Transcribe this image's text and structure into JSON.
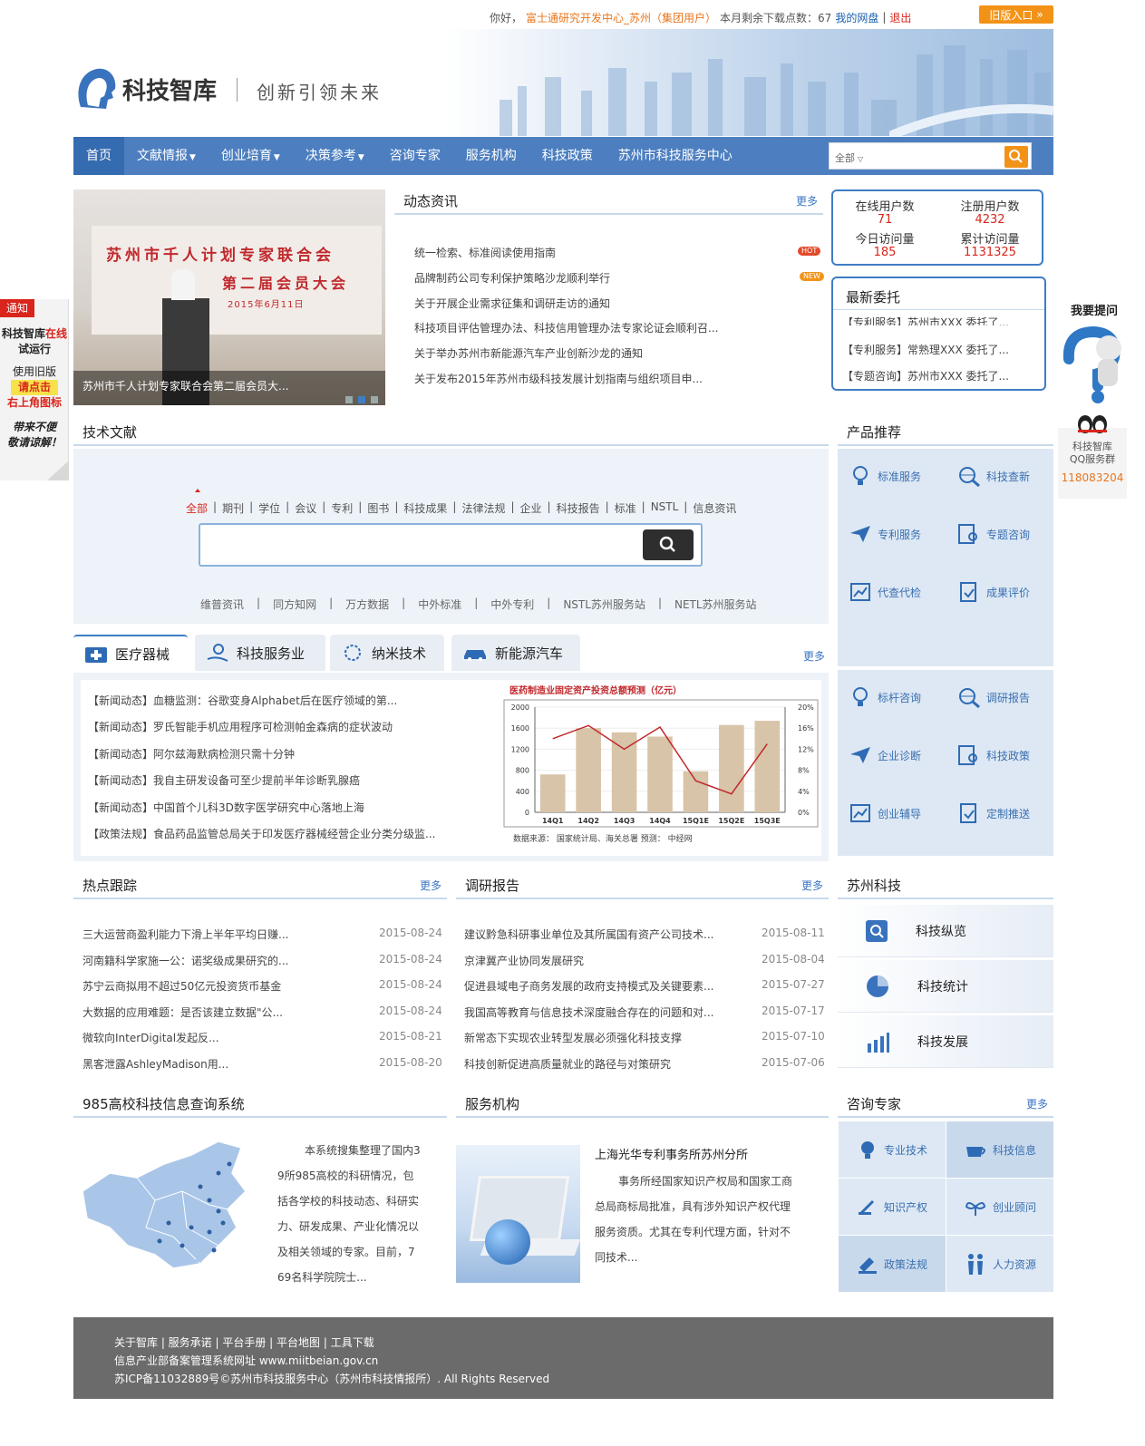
{
  "topbar": {
    "greeting": "你好，",
    "user": "富士通研究开发中心_苏州（集团用户）",
    "quota_label": "本月剩余下载点数：67",
    "my_disk": "我的网盘",
    "logout": "退出",
    "old_version": "旧版入口"
  },
  "header": {
    "logo_text": "科技智库",
    "slogan": "创新引领未来"
  },
  "nav": {
    "items": [
      {
        "label": "首页"
      },
      {
        "label": "文献情报"
      },
      {
        "label": "创业培育"
      },
      {
        "label": "决策参考"
      },
      {
        "label": "咨询专家"
      },
      {
        "label": "服务机构"
      },
      {
        "label": "科技政策"
      },
      {
        "label": "苏州市科技服务中心"
      }
    ],
    "search_scope": "全部"
  },
  "banner": {
    "line1": "苏州市千人计划专家联合会",
    "line2": "第二届会员大会",
    "line3": "2015年6月11日",
    "caption": "苏州市千人计划专家联合会第二届会员大..."
  },
  "news": {
    "title": "动态资讯",
    "more": "更多",
    "items": [
      "统一检索、标准阅读使用指南",
      "品牌制药公司专利保护策略沙龙顺利举行",
      "关于开展企业需求征集和调研走访的通知",
      "科技项目评估管理办法、科技信用管理办法专家论证会顺利召...",
      "关于举办苏州市新能源汽车产业创新沙龙的通知",
      "关于发布2015年苏州市级科技发展计划指南与组织项目申..."
    ],
    "hot": "HOT",
    "new": "NEW"
  },
  "stats": {
    "online_label": "在线用户数",
    "online": "71",
    "registered_label": "注册用户数",
    "registered": "4232",
    "today_label": "今日访问量",
    "today": "185",
    "total_label": "累计访问量",
    "total": "1131325"
  },
  "commission": {
    "title": "最新委托",
    "items": [
      "【专利服务】苏州市XXX 委托了...",
      "【专利服务】常熟理XXX 委托了...",
      "【专题咨询】苏州市XXX 委托了..."
    ]
  },
  "literature": {
    "title": "技术文献",
    "tabs": [
      "全部",
      "期刊",
      "学位",
      "会议",
      "专利",
      "图书",
      "科技成果",
      "法律法规",
      "企业",
      "科技报告",
      "标准",
      "NSTL",
      "信息资讯"
    ],
    "sources": [
      "维普资讯",
      "同方知网",
      "万方数据",
      "中外标准",
      "中外专利",
      "NSTL苏州服务站",
      "NETL苏州服务站"
    ]
  },
  "products": {
    "title": "产品推荐",
    "group1": [
      "标准服务",
      "科技查新",
      "专利服务",
      "专题咨询",
      "代查代检",
      "成果评价"
    ],
    "group2": [
      "标杆咨询",
      "调研报告",
      "企业诊断",
      "科技政策",
      "创业辅导",
      "定制推送"
    ]
  },
  "industry": {
    "tabs": [
      "医疗器械",
      "科技服务业",
      "纳米技术",
      "新能源汽车"
    ],
    "more": "更多",
    "items": [
      "【新闻动态】血糖监测：谷歌变身Alphabet后在医疗领域的第...",
      "【新闻动态】罗氏智能手机应用程序可检测帕金森病的症状波动",
      "【新闻动态】阿尔兹海默病检测只需十分钟",
      "【新闻动态】我自主研发设备可至少提前半年诊断乳腺癌",
      "【新闻动态】中国首个儿科3D数字医学研究中心落地上海",
      "【政策法规】食品药品监管总局关于印发医疗器械经营企业分类分级监..."
    ]
  },
  "chart_data": {
    "type": "bar",
    "title": "医药制造业固定资产投资总额预测（亿元）",
    "categories": [
      "14Q1",
      "14Q2",
      "14Q3",
      "14Q4",
      "15Q1E",
      "15Q2E",
      "15Q3E"
    ],
    "series": [
      {
        "values": [
          720,
          1600,
          1520,
          1440,
          780,
          1660,
          1740
        ]
      },
      {
        "values": [
          14,
          16.5,
          12,
          16.2,
          6,
          3.5,
          13
        ]
      }
    ],
    "ylim": [
      0,
      2000
    ],
    "yticks": [
      "2000",
      "1600",
      "1200",
      "800",
      "400",
      "0"
    ],
    "y2ticks": [
      "20%",
      "16%",
      "12%",
      "8%",
      "4%",
      "0%"
    ],
    "source": "数据来源： 国家统计局、海关总署     预测： 中经网"
  },
  "hot": {
    "title": "热点跟踪",
    "more": "更多",
    "items": [
      {
        "t": "三大运营商盈利能力下滑上半年平均日赚...",
        "d": "2015-08-24"
      },
      {
        "t": "河南籍科学家施一公：诺奖级成果研究的...",
        "d": "2015-08-24"
      },
      {
        "t": "苏宁云商拟用不超过50亿元投资货币基金",
        "d": "2015-08-24"
      },
      {
        "t": "大数据的应用难题：是否该建立数据\"公...",
        "d": "2015-08-24"
      },
      {
        "t": "微软向InterDigital发起反...",
        "d": "2015-08-21"
      },
      {
        "t": "黑客泄露AshleyMadison用...",
        "d": "2015-08-20"
      }
    ]
  },
  "reports": {
    "title": "调研报告",
    "more": "更多",
    "items": [
      {
        "t": "建议黔急科研事业单位及其所属国有资产公司技术...",
        "d": "2015-08-11"
      },
      {
        "t": "京津冀产业协同发展研究",
        "d": "2015-08-04"
      },
      {
        "t": "促进县域电子商务发展的政府支持模式及关键要素...",
        "d": "2015-07-27"
      },
      {
        "t": "我国高等教育与信息技术深度融合存在的问题和对...",
        "d": "2015-07-17"
      },
      {
        "t": "新常态下实现农业转型发展必须强化科技支撑",
        "d": "2015-07-10"
      },
      {
        "t": "科技创新促进高质量就业的路径与对策研究",
        "d": "2015-07-06"
      }
    ]
  },
  "suzhou": {
    "title": "苏州科技",
    "items": [
      "科技纵览",
      "科技统计",
      "科技发展"
    ]
  },
  "univ": {
    "title": "985高校科技信息查询系统",
    "lines": [
      "本系统搜集整理了国内3",
      "9所985高校的科研情况，包",
      "括各学校的科技动态、科研实",
      "力、研发成果、产业化情况以",
      "及相关领域的专家。目前，7",
      "69名科学院院士..."
    ]
  },
  "agency": {
    "title": "服务机构",
    "name": "上海光华专利事务所苏州分所",
    "lines": [
      "事务所经国家知识产权局和国家工商",
      "总局商标局批准，具有涉外知识产权代理",
      "服务资质。尤其在专利代理方面，针对不",
      "同技术..."
    ]
  },
  "experts": {
    "title": "咨询专家",
    "more": "更多",
    "items": [
      "专业技术",
      "科技信息",
      "知识产权",
      "创业顾问",
      "政策法规",
      "人力资源"
    ]
  },
  "footer": {
    "links": "关于智库 | 服务承诺 | 平台手册 | 平台地图 | 工具下载",
    "beian": "信息产业部备案管理系统网址 www.miitbeian.gov.cn",
    "copy": "苏ICP备11032889号©苏州市科技服务中心（苏州市科技情报所）. All Rights Reserved"
  },
  "notice": {
    "tag": "通知",
    "l1a": "科技智库",
    "l1b": "在线",
    "l2": "试运行",
    "l3": "使用旧版",
    "l4": "请点击",
    "l5": "右上角图标",
    "l6": "带来不便",
    "l7": "敬请谅解！"
  },
  "float": {
    "ask": "我要提问",
    "qq_l1": "科技智库",
    "qq_l2": "QQ服务群",
    "qq_num": "118083204"
  },
  "colors": {
    "nav": "#4d7fc0",
    "accent": "#f29318",
    "red": "#d9251c",
    "link": "#3b76c3"
  }
}
